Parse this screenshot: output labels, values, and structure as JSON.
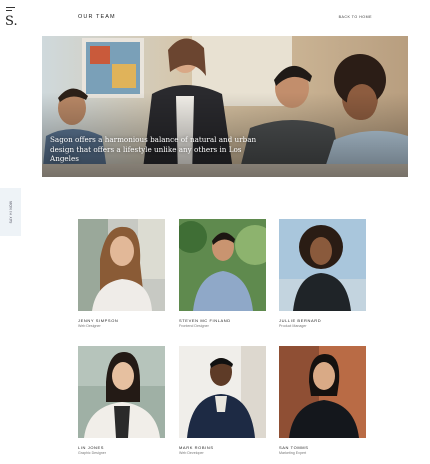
{
  "brand": {
    "logo": "S",
    "logo_dot": "."
  },
  "side_tab": {
    "label": "SAY HI NOW"
  },
  "header": {
    "title": "OUR TEAM",
    "back_link": "BACK TO HOME"
  },
  "hero": {
    "caption": "Sagon offers a harmonious balance of natural and urban design that offers a lifestyle unlike any others in Los Angeles"
  },
  "team": [
    {
      "name": "JENNY SIMPSON",
      "role": "Web Designer"
    },
    {
      "name": "STEVEN MC FINLAND",
      "role": "Frontend Designer"
    },
    {
      "name": "JULLIE BERNARD",
      "role": "Product Manager"
    },
    {
      "name": "LIN JONES",
      "role": "Graphic Designer"
    },
    {
      "name": "MARK ROBINS",
      "role": "Web Developer"
    },
    {
      "name": "SAN TOMMS",
      "role": "Marketing Expert"
    }
  ],
  "colors": {
    "accent_tab": "#eef3f7",
    "text": "#222222",
    "muted": "#777777"
  }
}
